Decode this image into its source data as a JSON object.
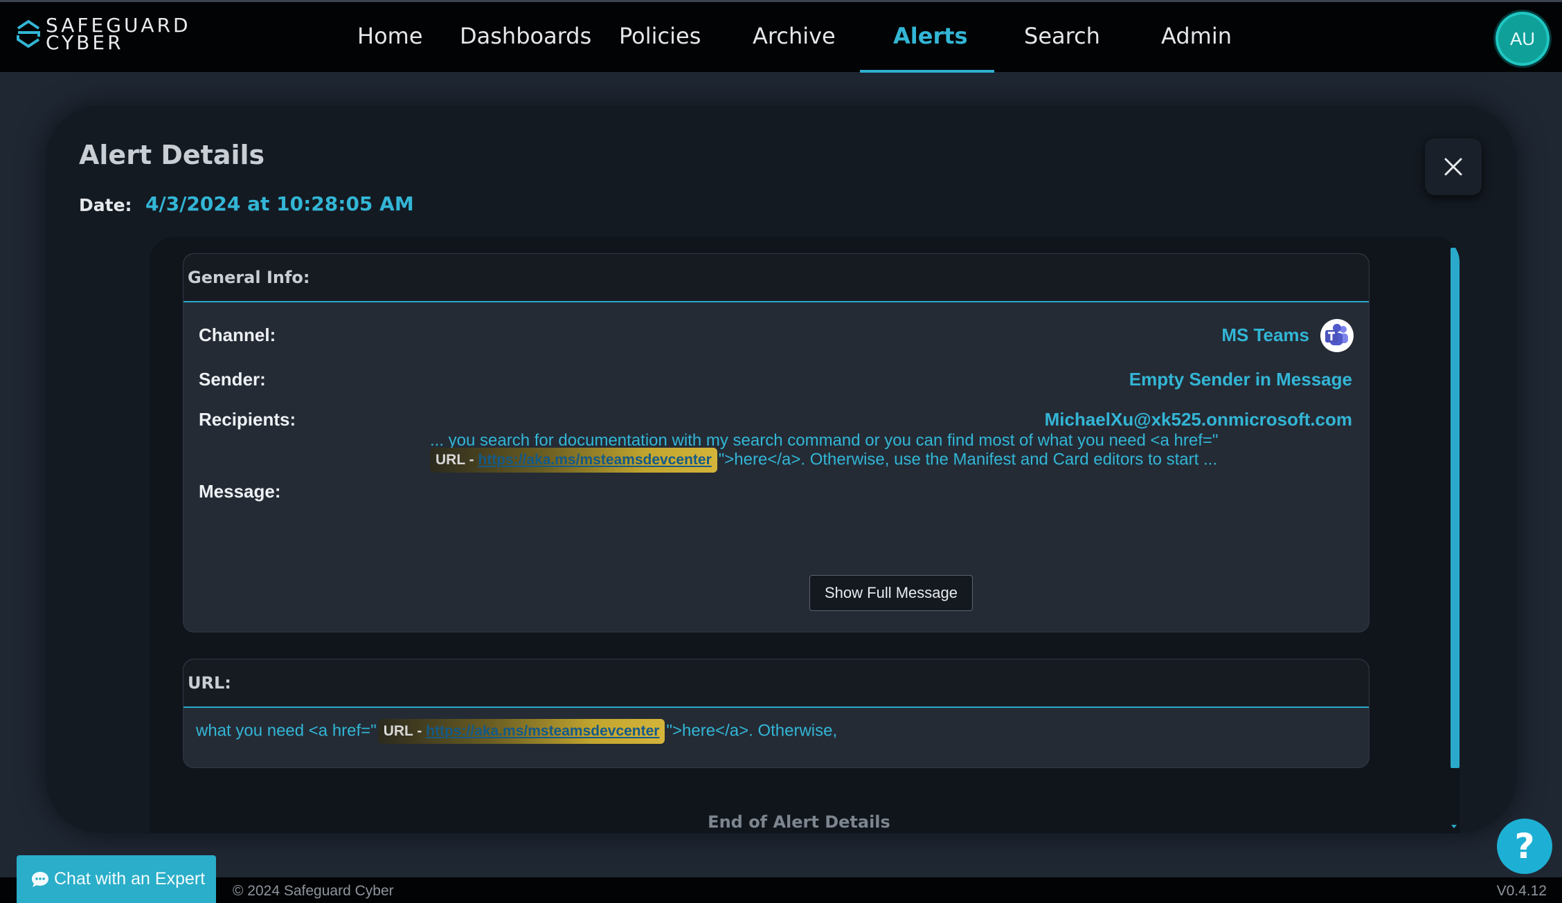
{
  "brand": {
    "line1": "SAFEGUARD",
    "line2": "CYBER"
  },
  "nav": {
    "items": [
      {
        "label": "Home"
      },
      {
        "label": "Dashboards"
      },
      {
        "label": "Policies"
      },
      {
        "label": "Archive"
      },
      {
        "label": "Alerts",
        "active": true
      },
      {
        "label": "Search"
      },
      {
        "label": "Admin"
      }
    ],
    "avatar_initials": "AU"
  },
  "alert": {
    "title": "Alert Details",
    "date_label": "Date:",
    "date_value": "4/3/2024 at 10:28:05 AM",
    "general_info": {
      "header": "General Info:",
      "channel_label": "Channel:",
      "channel_value": "MS Teams",
      "sender_label": "Sender:",
      "sender_value": "Empty Sender in Message",
      "recipients_label": "Recipients:",
      "recipients_value": "MichaelXu@xk525.onmicrosoft.com",
      "message_label": "Message:",
      "message_line1": "... you search for documentation with my search command or you can find most of what you need <a href=\"",
      "message_chip_prefix": "URL - ",
      "message_chip_link": "https://aka.ms/msteamsdevcenter",
      "message_line2_suffix": "\">here</a>. Otherwise, use the Manifest and Card editors to start ...",
      "show_full_button": "Show Full Message"
    },
    "url_section": {
      "header": "URL:",
      "prefix_text": "what you need <a href=\"",
      "chip_prefix": "URL - ",
      "chip_link": "https://aka.ms/msteamsdevcenter",
      "suffix_text": "\">here</a>. Otherwise,"
    },
    "end_text": "End of Alert Details"
  },
  "footer": {
    "copyright": "© 2024 Safeguard Cyber",
    "version": "V0.4.12",
    "chat_button": "Chat with an Expert",
    "help_symbol": "?"
  },
  "colors": {
    "accent": "#33b6d6",
    "background": "#1f2733",
    "topbar": "#020304",
    "chip_highlight": "#d4b43a"
  },
  "icons": [
    "logo-mark-icon",
    "close-icon",
    "ms-teams-icon",
    "chat-bubble-icon",
    "help-icon"
  ]
}
